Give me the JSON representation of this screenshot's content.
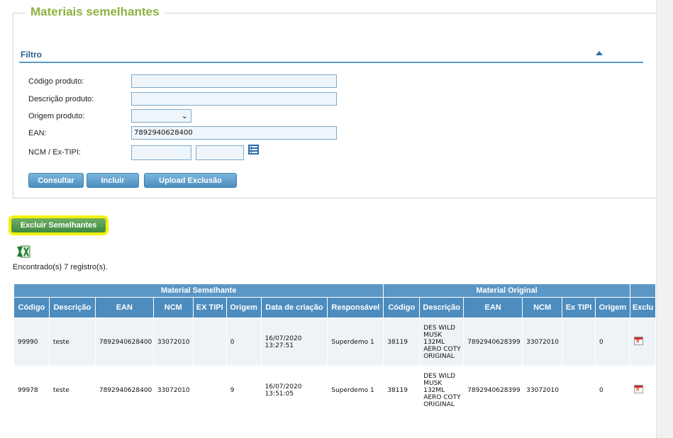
{
  "section_title": "Materiais semelhantes",
  "filter": {
    "title": "Filtro",
    "fields": {
      "codigo_label": "Código produto:",
      "codigo_value": "",
      "descricao_label": "Descrição produto:",
      "descricao_value": "",
      "origem_label": "Origem produto:",
      "origem_value": "",
      "ean_label": "EAN:",
      "ean_value": "7892940628400",
      "ncm_label": "NCM / Ex-TIPI:",
      "ncm_value": "",
      "extipi_value": ""
    },
    "buttons": {
      "consultar": "Consultar",
      "incluir": "Incluir",
      "upload": "Upload Exclusão"
    }
  },
  "excluir_button": "Excluir Semelhantes",
  "records_count_text": "Encontrado(s) 7 registro(s).",
  "table": {
    "group_headers": {
      "semelhante": "Material Semelhante",
      "original": "Material Original",
      "last": ""
    },
    "columns": [
      "Código",
      "Descrição",
      "EAN",
      "NCM",
      "EX TIPI",
      "Origem",
      "Data de criação",
      "Responsável",
      "Código",
      "Descrição",
      "EAN",
      "NCM",
      "Ex TIPI",
      "Origem",
      "Exclu"
    ],
    "rows": [
      {
        "codigo": "99990",
        "descricao": "teste",
        "ean": "7892940628400",
        "ncm": "33072010",
        "extipi": "",
        "origem": "0",
        "data": "16/07/2020 13:27:51",
        "responsavel": "Superdemo 1",
        "o_codigo": "38119",
        "o_descricao": "DES WILD MUSK 132ML AERO COTY ORIGINAL",
        "o_ean": "7892940628399",
        "o_ncm": "33072010",
        "o_extipi": "",
        "o_origem": "0"
      },
      {
        "codigo": "99978",
        "descricao": "teste",
        "ean": "7892940628400",
        "ncm": "33072010",
        "extipi": "",
        "origem": "9",
        "data": "16/07/2020 13:51:05",
        "responsavel": "Superdemo 1",
        "o_codigo": "38119",
        "o_descricao": "DES WILD MUSK 132ML AERO COTY ORIGINAL",
        "o_ean": "7892940628399",
        "o_ncm": "33072010",
        "o_extipi": "",
        "o_origem": "0"
      }
    ]
  },
  "icons": {
    "collapse": "chevron-up-icon",
    "ncm_lookup": "list-icon",
    "export": "excel-icon",
    "delete": "delete-icon"
  }
}
